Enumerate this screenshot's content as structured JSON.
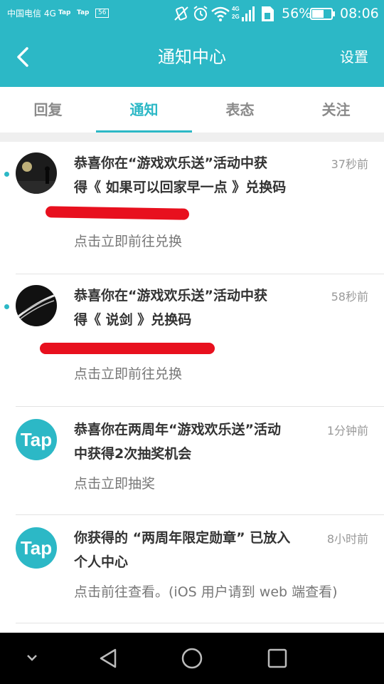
{
  "status_bar": {
    "carrier": "中国电信 4G",
    "mini_icon_1": "Tap",
    "mini_icon_2": "Tap",
    "mini_icon_3": "56",
    "signal_label": "4G 2G",
    "battery": "56%",
    "time": "08:06"
  },
  "header": {
    "title": "通知中心",
    "settings_label": "设置"
  },
  "tabs": [
    {
      "label": "回复",
      "active": false
    },
    {
      "label": "通知",
      "active": true
    },
    {
      "label": "表态",
      "active": false
    },
    {
      "label": "关注",
      "active": false
    }
  ],
  "notifications": [
    {
      "title_line1": "恭喜你在“游戏欢乐送”活动中获",
      "title_line2": "得《 如果可以回家早一点 》兑换码",
      "time": "37秒前",
      "action": "点击立即前往兑换",
      "unread": true,
      "avatar": "night-scene-avatar"
    },
    {
      "title_line1": "恭喜你在“游戏欢乐送”活动中获",
      "title_line2": "得《 说剑 》兑换码",
      "time": "58秒前",
      "action": "点击立即前往兑换",
      "unread": true,
      "avatar": "sword-avatar"
    },
    {
      "title_line1": "恭喜你在两周年“游戏欢乐送”活动",
      "title_line2": "中获得2次抽奖机会",
      "time": "1分钟前",
      "action": "点击立即抽奖",
      "unread": false,
      "avatar_text": "Tap"
    },
    {
      "title_line1": "你获得的 “两周年限定勋章” 已放入",
      "title_line2": "个人中心",
      "time": "8小时前",
      "action": "点击前往查看。(iOS 用户请到 web 端查看)",
      "unread": false,
      "avatar_text": "Tap"
    }
  ],
  "colors": {
    "accent": "#2cb8c6",
    "redaction": "#e8101e",
    "nav_bar": "#000000"
  }
}
